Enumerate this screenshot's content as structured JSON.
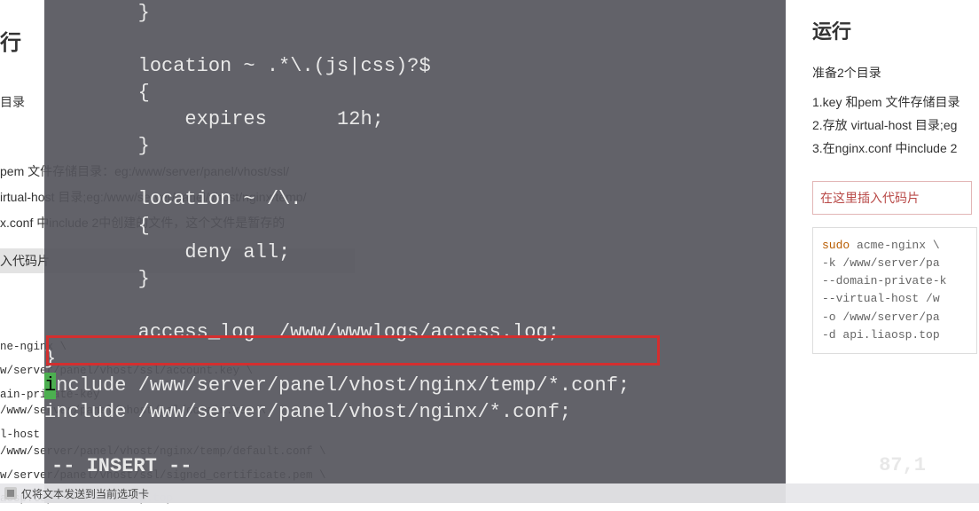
{
  "bg_left": {
    "heading": "行",
    "sub": "目录",
    "lines": [
      "pem 文件存储目录：eg:/www/server/panel/vhost/ssl/",
      "irtual-host 目录;eg:/www/server/panel/vhost/nginx/temp/",
      "x.conf 中include 2中创建的文件，这个文件是暂存的"
    ],
    "snippet": "入代码片",
    "cmd": [
      "ne-nginx \\",
      "w/server/panel/vhost/ssl/account.key \\",
      "ain-private-key /www/server/panel/vhost/ssl/domain.key \\",
      "l-host /www/server/panel/vhost/nginx/temp/default.conf \\",
      "w/server/panel/vhost/ssl/signed_certificate.pem \\",
      "aosp.top -d www.liaosp.top"
    ]
  },
  "terminal": {
    "lines_pre": "        }\n\n        location ~ .*\\.(js|css)?$\n        {\n            expires      12h;\n        }\n\n        location ~ /\\.\n        {\n            deny all;\n        }\n\n        access_log  /www/wwwlogs/access.log;\n}",
    "highlight_first_char": "i",
    "highlight_rest": "nclude /www/server/panel/vhost/nginx/temp/*.conf;",
    "line_after": "include /www/server/panel/vhost/nginx/*.conf;",
    "status": "-- INSERT --",
    "cursor_pos": "87,1"
  },
  "tabbar": {
    "text": "仅将文本发送到当前选项卡"
  },
  "right": {
    "heading": "运行",
    "sub": "准备2个目录",
    "numbered": [
      "1.key 和pem 文件存储目录",
      "2.存放 virtual-host 目录;eg",
      "3.在nginx.conf 中include 2"
    ],
    "insert_box": "在这里插入代码片",
    "code_kw": "sudo",
    "code_cmd": " acme-nginx \\",
    "code_lines": [
      "  -k /www/server/pa",
      "  --domain-private-k",
      "  --virtual-host /w",
      "  -o /www/server/pa",
      "  -d api.liaosp.top"
    ]
  }
}
